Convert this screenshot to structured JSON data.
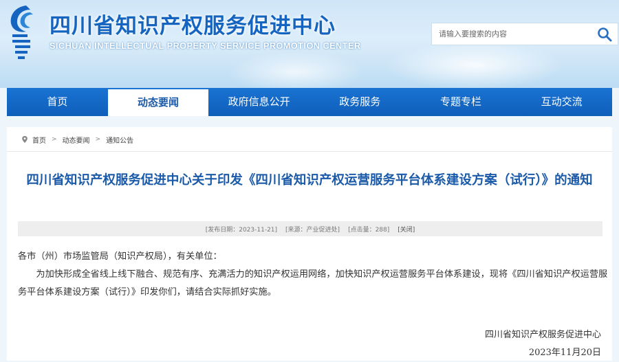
{
  "header": {
    "title": "四川省知识产权服务促进中心",
    "subtitle": "SICHUAN INTELLECTUAL PROPERTY SERVICE PROMOTION CENTER",
    "logo_icon": "sichuan-ip-logo",
    "brand_color": "#1565c0"
  },
  "search": {
    "placeholder": "请输入要搜索的内容",
    "icon": "search-icon"
  },
  "nav": {
    "items": [
      {
        "label": "首页",
        "active": false
      },
      {
        "label": "动态要闻",
        "active": true
      },
      {
        "label": "政府信息公开",
        "active": false
      },
      {
        "label": "政务服务",
        "active": false
      },
      {
        "label": "专题专栏",
        "active": false
      },
      {
        "label": "互动交流",
        "active": false
      }
    ],
    "color": "#1a72d2"
  },
  "breadcrumb": {
    "items": [
      "首页",
      "动态要闻",
      "通知公告"
    ],
    "separator": ">"
  },
  "article": {
    "title": "四川省知识产权服务促进中心关于印发《四川省知识产权运营服务平台体系建设方案（试行）》的通知",
    "meta": {
      "date": "[发布日期：2023-11-21]",
      "source": "[来源：产业促进处]",
      "views": "[点击量：288]",
      "close": "[关闭]"
    },
    "salutation": "各市（州）市场监管局（知识产权局），有关单位：",
    "paragraph": "为加快形成全省线上线下融合、规范有序、充满活力的知识产权运用网络，加快知识产权运营服务平台体系建设，现将《四川省知识产权运营服务平台体系建设方案（试行）》印发你们，请结合实际抓好实施。",
    "signature_org": "四川省知识产权服务促进中心",
    "signature_date": "2023年11月20日"
  }
}
